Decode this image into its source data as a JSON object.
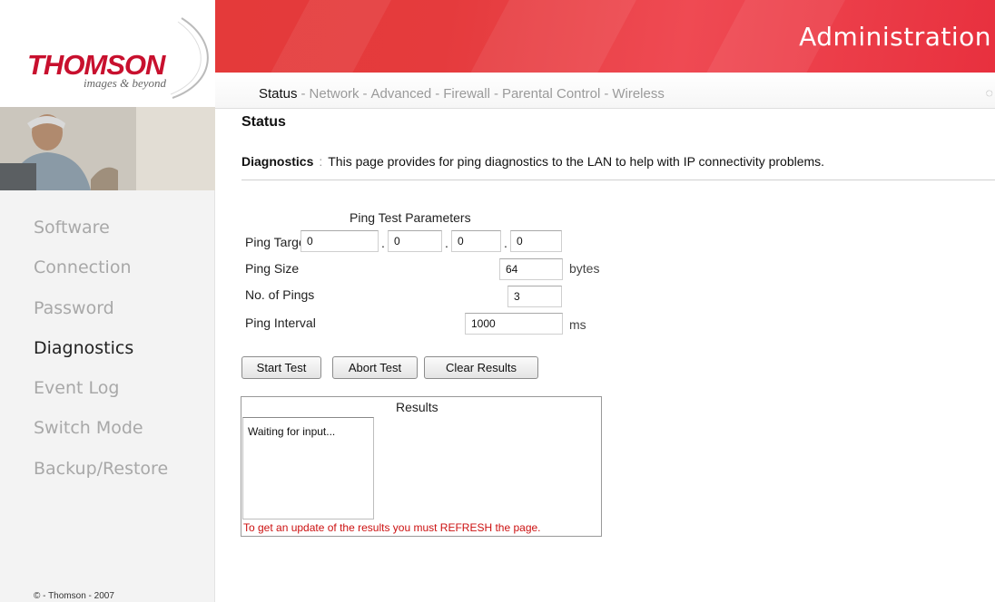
{
  "brand": {
    "name": "THOMSON",
    "tagline": "images & beyond"
  },
  "header": {
    "title": "Administration"
  },
  "top_nav": {
    "items": [
      {
        "label": "Status",
        "active": true
      },
      {
        "label": "Network",
        "active": false
      },
      {
        "label": "Advanced",
        "active": false
      },
      {
        "label": "Firewall",
        "active": false
      },
      {
        "label": "Parental Control",
        "active": false
      },
      {
        "label": "Wireless",
        "active": false
      }
    ],
    "separator": "-"
  },
  "sidebar": {
    "items": [
      {
        "label": "Software",
        "active": false
      },
      {
        "label": "Connection",
        "active": false
      },
      {
        "label": "Password",
        "active": false
      },
      {
        "label": "Diagnostics",
        "active": true
      },
      {
        "label": "Event Log",
        "active": false
      },
      {
        "label": "Switch Mode",
        "active": false
      },
      {
        "label": "Backup/Restore",
        "active": false
      }
    ],
    "copyright": "© - Thomson - 2007"
  },
  "page": {
    "title": "Status",
    "section": "Diagnostics",
    "separator": ":",
    "description": "This page provides for ping diagnostics to the LAN to help with IP connectivity problems."
  },
  "ping": {
    "heading": "Ping Test Parameters",
    "target_label": "Ping Target",
    "target_octets": [
      "0",
      "0",
      "0",
      "0"
    ],
    "octet_separator": ".",
    "size_label": "Ping Size",
    "size_value": "64",
    "size_unit": "bytes",
    "count_label": "No. of Pings",
    "count_value": "3",
    "interval_label": "Ping Interval",
    "interval_value": "1000",
    "interval_unit": "ms"
  },
  "buttons": {
    "start": "Start Test",
    "abort": "Abort Test",
    "clear": "Clear Results"
  },
  "results": {
    "heading": "Results",
    "output": "Waiting for input...",
    "note": "To get an update of the results you must REFRESH the page."
  },
  "colors": {
    "brand_red": "#c8102e",
    "banner_red": "#e43a3a",
    "note_red": "#cc1010",
    "inactive_nav": "#a8a8a8"
  }
}
